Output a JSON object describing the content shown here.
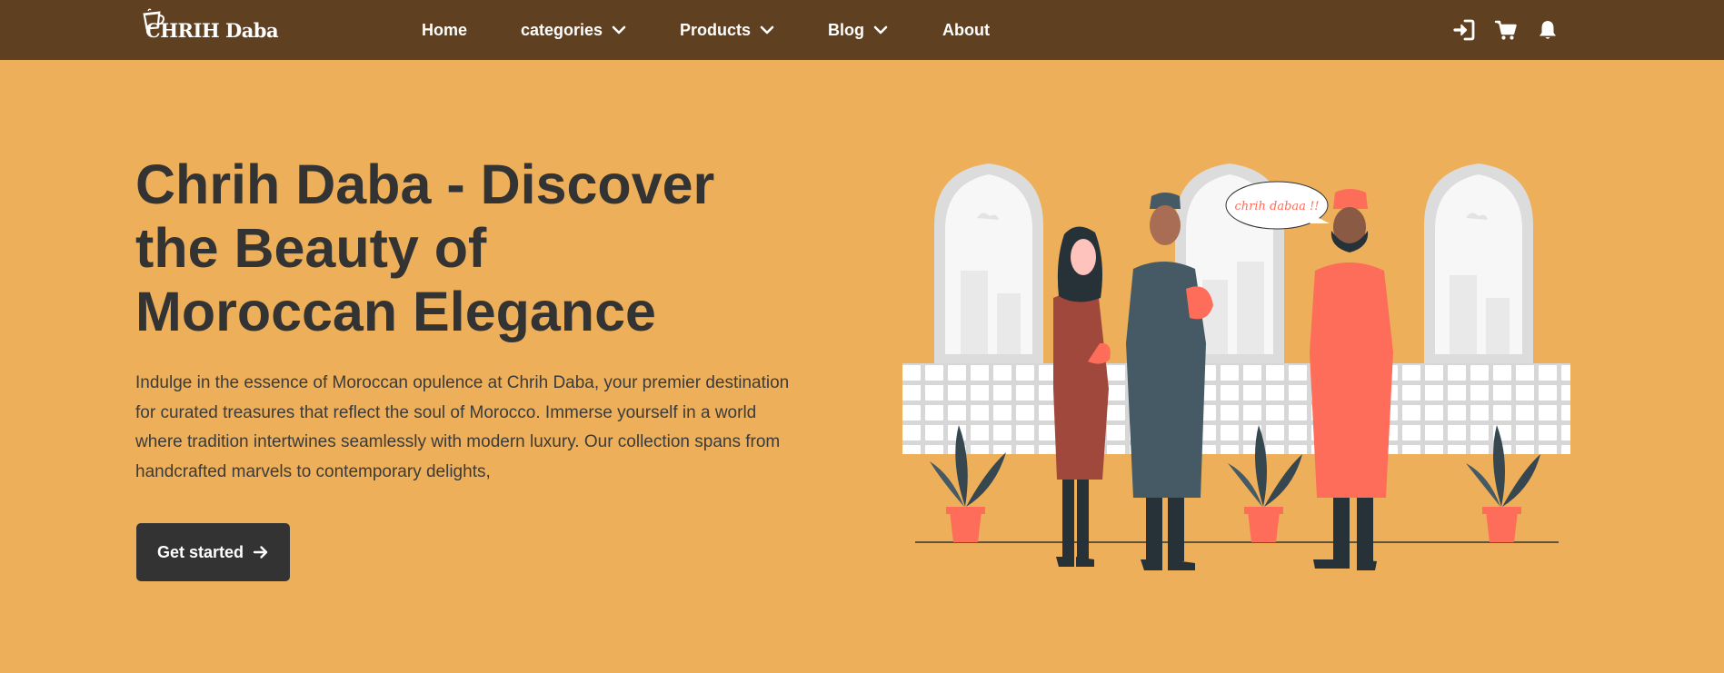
{
  "nav": {
    "logo_text": "CHRIH Daba",
    "items": [
      {
        "label": "Home",
        "dropdown": false
      },
      {
        "label": "categories",
        "dropdown": true
      },
      {
        "label": "Products",
        "dropdown": true
      },
      {
        "label": "Blog",
        "dropdown": true
      },
      {
        "label": "About",
        "dropdown": false
      }
    ],
    "icons": [
      "login-icon",
      "cart-icon",
      "bell-icon"
    ]
  },
  "hero": {
    "title_lines": [
      "Chrih Daba - Discover",
      "the Beauty of",
      "Moroccan Elegance"
    ],
    "description_lines": [
      "Indulge in the essence of Moroccan opulence at Chrih Daba, your premier destination",
      "for curated treasures that reflect the soul of Morocco. Immerse yourself in a world",
      "where tradition intertwines seamlessly with modern luxury. Our collection spans from",
      "handcrafted marvels to contemporary delights,"
    ],
    "cta_label": "Get started",
    "cta_icon": "arrow-right-icon"
  },
  "illustration": {
    "speech_bubble": "chrih dabaa !!"
  },
  "colors": {
    "nav_bg": "#5f4020",
    "page_bg": "#edaf59",
    "text_dark": "#333333",
    "button_bg": "#333333",
    "accent_coral": "#fe6d5a"
  }
}
